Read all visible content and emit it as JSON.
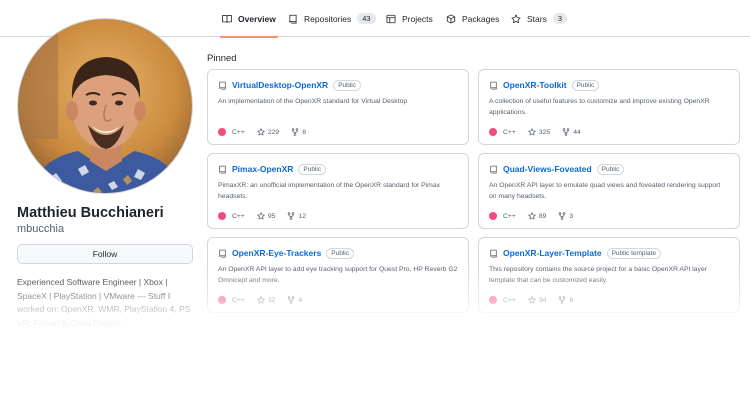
{
  "tabs": [
    {
      "label": "Overview",
      "icon": "book-icon",
      "active": true
    },
    {
      "label": "Repositories",
      "icon": "repo-icon",
      "count": "43"
    },
    {
      "label": "Projects",
      "icon": "table-icon"
    },
    {
      "label": "Packages",
      "icon": "package-icon"
    },
    {
      "label": "Stars",
      "icon": "star-icon",
      "count": "3"
    }
  ],
  "profile": {
    "full_name": "Matthieu Bucchianeri",
    "login": "mbucchia",
    "follow_label": "Follow",
    "bio": "Experienced Software Engineer | Xbox | SpaceX | PlayStation | VMware --- Stuff I worked on: OpenXR, WMR, PlayStation 4, PS VR, Falcon 9, Crew Dragon"
  },
  "pinned": {
    "title": "Pinned",
    "repos": [
      {
        "name": "VirtualDesktop-OpenXR",
        "visibility": "Public",
        "description": "An implementation of the OpenXR standard for Virtual Desktop",
        "language": "C++",
        "stars": "229",
        "forks": "8"
      },
      {
        "name": "OpenXR-Toolkit",
        "visibility": "Public",
        "description": "A collection of useful features to customize and improve existing OpenXR applications.",
        "language": "C++",
        "stars": "325",
        "forks": "44"
      },
      {
        "name": "Pimax-OpenXR",
        "visibility": "Public",
        "description": "PimaxXR: an unofficial implementation of the OpenXR standard for Pimax headsets.",
        "language": "C++",
        "stars": "95",
        "forks": "12"
      },
      {
        "name": "Quad-Views-Foveated",
        "visibility": "Public",
        "description": "An OpenXR API layer to emulate quad views and foveated rendering support on many headsets.",
        "language": "C++",
        "stars": "89",
        "forks": "3"
      },
      {
        "name": "OpenXR-Eye-Trackers",
        "visibility": "Public",
        "description": "An OpenXR API layer to add eye tracking support for Quest Pro, HP Reverb G2 Omnicept and more.",
        "language": "C++",
        "stars": "32",
        "forks": "4"
      },
      {
        "name": "OpenXR-Layer-Template",
        "visibility": "Public template",
        "description": "This repository contains the source project for a basic OpenXR API layer template that can be customized easily.",
        "language": "C++",
        "stars": "34",
        "forks": "6"
      }
    ]
  },
  "colors": {
    "accent_underline": "#fd8c73",
    "link": "#0969da",
    "cpp": "#f34b7d"
  }
}
